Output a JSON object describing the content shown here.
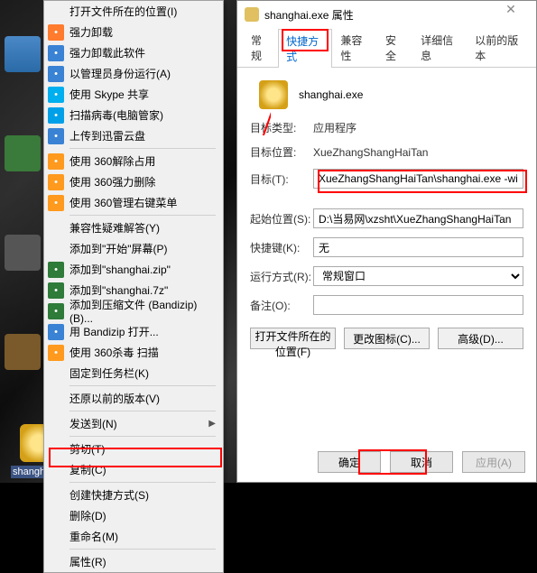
{
  "desktop_shortcut_label": "shanghai.ex",
  "context_menu": {
    "items": [
      {
        "label": "打开文件所在的位置(I)",
        "icon": "",
        "submenu": false
      },
      {
        "label": "强力卸载",
        "icon": "uninstall",
        "iconBg": "#ff7b2e",
        "submenu": false
      },
      {
        "label": "强力卸载此软件",
        "icon": "uninstall2",
        "iconBg": "#3a82d4",
        "submenu": false
      },
      {
        "label": "以管理员身份运行(A)",
        "icon": "shield",
        "iconBg": "#3a82d4",
        "submenu": false
      },
      {
        "label": "使用 Skype 共享",
        "icon": "skype",
        "iconBg": "#00aff0",
        "submenu": false
      },
      {
        "label": "扫描病毒(电脑管家)",
        "icon": "scan",
        "iconBg": "#00a0e9",
        "submenu": false
      },
      {
        "label": "上传到迅雷云盘",
        "icon": "cloud",
        "iconBg": "#3a82d4",
        "submenu": false
      },
      {
        "sep": true
      },
      {
        "label": "使用 360解除占用",
        "icon": "360",
        "iconBg": "#ff9a1e",
        "submenu": false
      },
      {
        "label": "使用 360强力删除",
        "icon": "360del",
        "iconBg": "#ff9a1e",
        "submenu": false
      },
      {
        "label": "使用 360管理右键菜单",
        "icon": "360menu",
        "iconBg": "#ff9a1e",
        "submenu": false
      },
      {
        "sep": true
      },
      {
        "label": "兼容性疑难解答(Y)",
        "icon": "",
        "submenu": false
      },
      {
        "label": "添加到\"开始\"屏幕(P)",
        "icon": "",
        "submenu": false
      },
      {
        "label": "添加到\"shanghai.zip\"",
        "icon": "zip",
        "iconBg": "#2e7b3a",
        "submenu": false
      },
      {
        "label": "添加到\"shanghai.7z\"",
        "icon": "7z",
        "iconBg": "#2e7b3a",
        "submenu": false
      },
      {
        "label": "添加到压缩文件 (Bandizip)(B)...",
        "icon": "bandizip",
        "iconBg": "#2e7b3a",
        "submenu": false
      },
      {
        "label": "用 Bandizip 打开...",
        "icon": "bopen",
        "iconBg": "#3a82d4",
        "submenu": false
      },
      {
        "label": "使用 360杀毒 扫描",
        "icon": "360av",
        "iconBg": "#ff9a1e",
        "submenu": false
      },
      {
        "label": "固定到任务栏(K)",
        "icon": "",
        "submenu": false
      },
      {
        "sep": true
      },
      {
        "label": "还原以前的版本(V)",
        "icon": "",
        "submenu": false
      },
      {
        "sep": true
      },
      {
        "label": "发送到(N)",
        "icon": "",
        "submenu": true
      },
      {
        "sep": true
      },
      {
        "label": "剪切(T)",
        "icon": "",
        "submenu": false
      },
      {
        "label": "复制(C)",
        "icon": "",
        "submenu": false
      },
      {
        "sep": true
      },
      {
        "label": "创建快捷方式(S)",
        "icon": "",
        "submenu": false
      },
      {
        "label": "删除(D)",
        "icon": "",
        "submenu": false
      },
      {
        "label": "重命名(M)",
        "icon": "",
        "submenu": false
      },
      {
        "sep": true
      },
      {
        "label": "属性(R)",
        "icon": "",
        "submenu": false
      }
    ]
  },
  "properties": {
    "title": "shanghai.exe 属性",
    "tabs": [
      "常规",
      "快捷方式",
      "兼容性",
      "安全",
      "详细信息",
      "以前的版本"
    ],
    "active_tab": 1,
    "header_filename": "shanghai.exe",
    "fields": {
      "target_type_label": "目标类型:",
      "target_type_value": "应用程序",
      "target_location_label": "目标位置:",
      "target_location_value": "XueZhangShangHaiTan",
      "target_label": "目标(T):",
      "target_value": "XueZhangShangHaiTan\\shanghai.exe -windows",
      "start_in_label": "起始位置(S):",
      "start_in_value": "D:\\当易网\\xzsht\\XueZhangShangHaiTan",
      "shortcut_key_label": "快捷键(K):",
      "shortcut_key_value": "无",
      "run_label": "运行方式(R):",
      "run_value": "常规窗口",
      "comment_label": "备注(O):",
      "comment_value": ""
    },
    "mid_buttons": [
      "打开文件所在的位置(F)",
      "更改图标(C)...",
      "高级(D)..."
    ],
    "footer_buttons": {
      "ok": "确定",
      "cancel": "取消",
      "apply": "应用(A)"
    }
  }
}
